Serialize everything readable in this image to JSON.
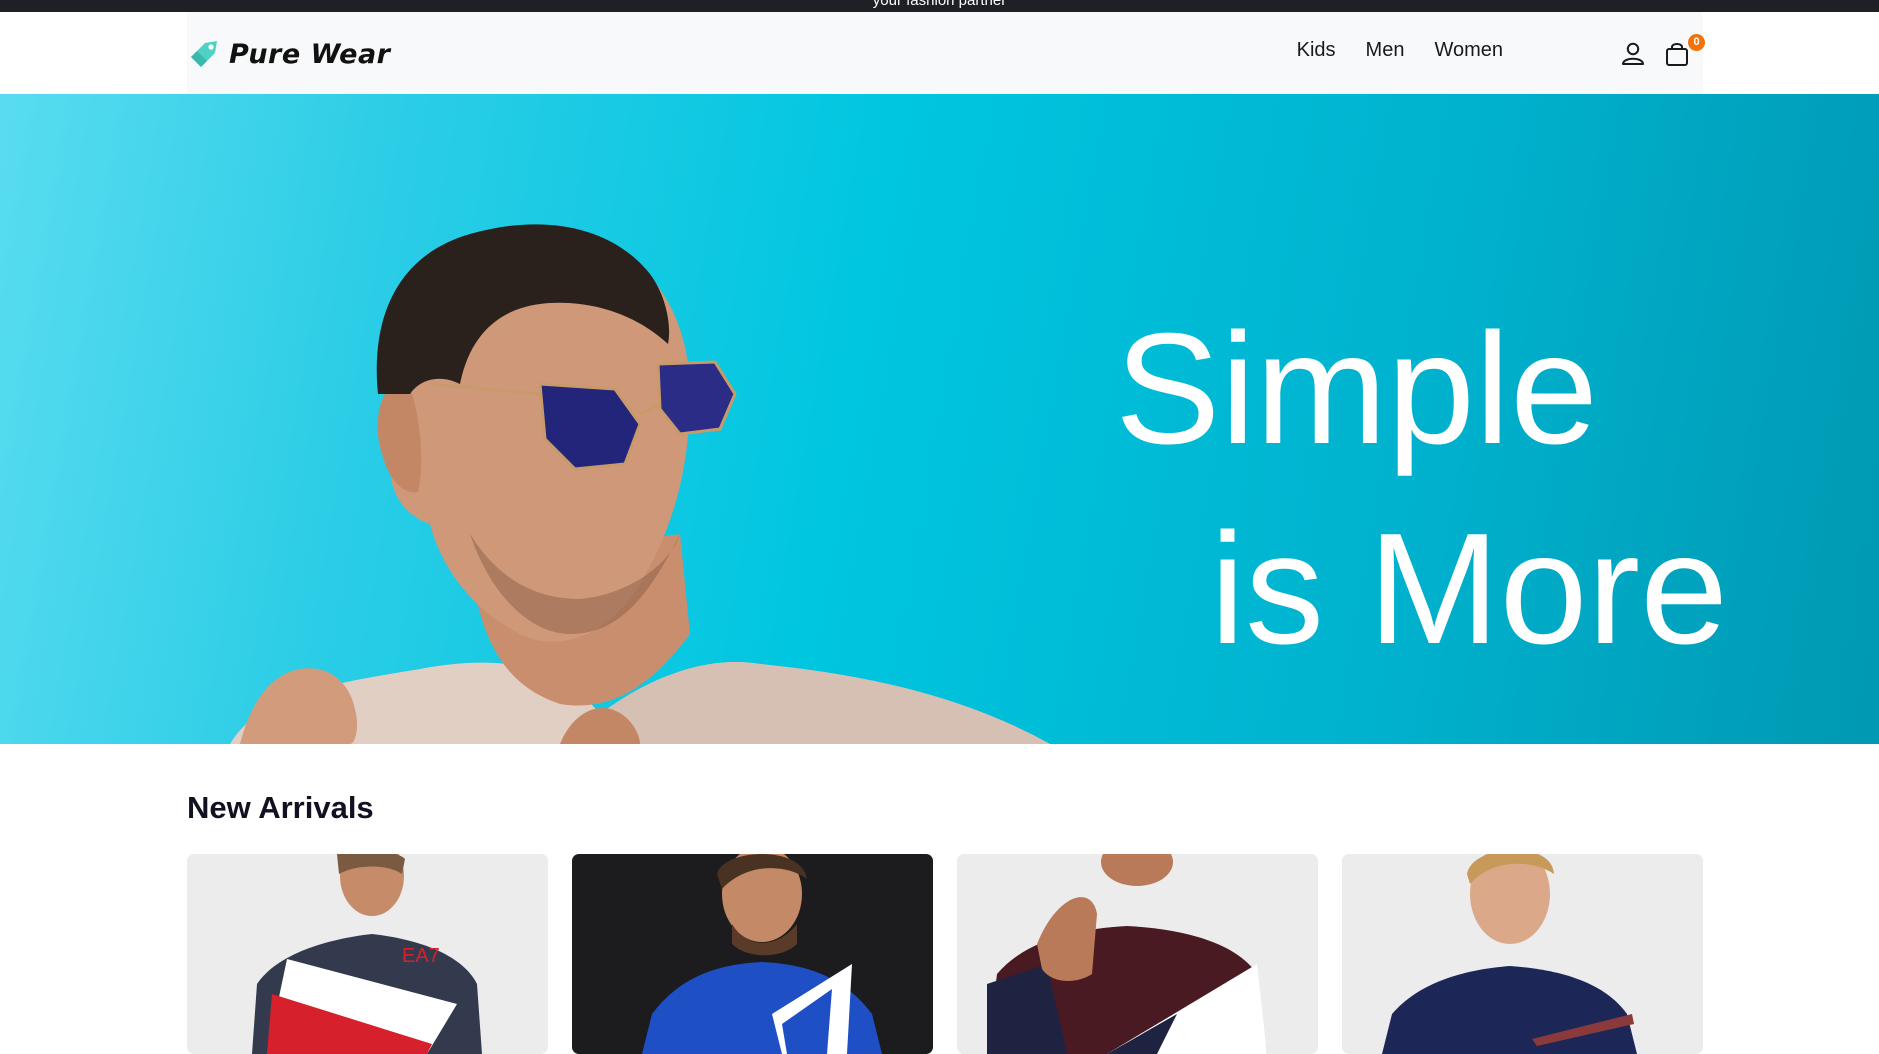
{
  "announcement": {
    "text": "your fashion partner"
  },
  "brand": {
    "name": "Pure Wear",
    "icon": "tag-icon",
    "accent": "#4fd1c5"
  },
  "nav": {
    "links": [
      {
        "label": "Kids"
      },
      {
        "label": "Men"
      },
      {
        "label": "Women"
      }
    ],
    "user_icon": "user-icon",
    "cart_icon": "shopping-bag-icon",
    "cart_count": "0",
    "badge_color": "#f2720c"
  },
  "hero": {
    "line1": "Simple",
    "line2": "is More",
    "background": "#00c6e0"
  },
  "new_arrivals": {
    "title": "New Arrivals",
    "products": [
      {
        "image": "man in navy, white and red colour-block t-shirt"
      },
      {
        "image": "man in blue and white t-shirt on dark background"
      },
      {
        "image": "man in maroon, white and navy colour-block t-shirt"
      },
      {
        "image": "man in navy printed t-shirt"
      }
    ]
  }
}
